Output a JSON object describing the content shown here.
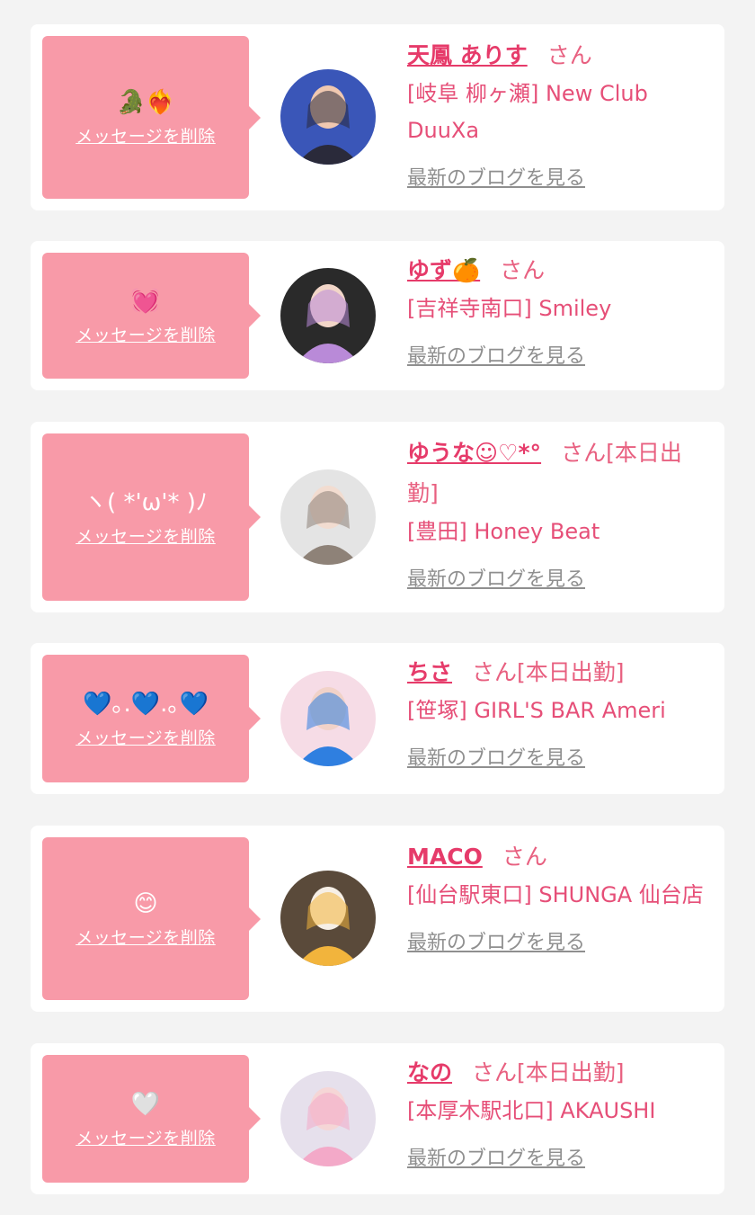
{
  "common": {
    "san": "さん",
    "delete_label": "メッセージを削除",
    "blog_label": "最新のブログを見る"
  },
  "cards": [
    {
      "message": "🐊❤️‍🔥",
      "name": "天鳳 ありす",
      "tag": "",
      "shop": "[岐阜 柳ヶ瀬] New Club DuuXa",
      "avatar_icon": "portrait-photo",
      "avatar_colors": [
        "#3a56b8",
        "#f0c8b0",
        "#2a2a3a"
      ]
    },
    {
      "message": "💓",
      "name": "ゆず🍊",
      "tag": "",
      "shop": "[吉祥寺南口] Smiley",
      "avatar_icon": "portrait-photo",
      "avatar_colors": [
        "#2a2a2a",
        "#f2d6c8",
        "#b98ad8"
      ]
    },
    {
      "message": "ヽ( *'ω'* )ﾉ",
      "name": "ゆうな☺︎♡*°",
      "tag": "[本日出勤]",
      "shop": "[豊田] Honey Beat",
      "avatar_icon": "portrait-photo",
      "avatar_colors": [
        "#e4e4e4",
        "#f2dcd0",
        "#8e8278"
      ]
    },
    {
      "message": "💙｡.💙.｡💙",
      "name": "ちさ",
      "tag": "[本日出勤]",
      "shop": "[笹塚] GIRL'S BAR Ameri",
      "avatar_icon": "portrait-photo",
      "avatar_colors": [
        "#f6dce6",
        "#f1d2c8",
        "#2f7fe0"
      ]
    },
    {
      "message": "😊",
      "name": "MACO",
      "tag": "",
      "shop": "[仙台駅東口] SHUNGA 仙台店",
      "avatar_icon": "portrait-photo",
      "avatar_colors": [
        "#5a4a3a",
        "#f6efe6",
        "#f2b43c"
      ]
    },
    {
      "message": "🤍",
      "name": "なの",
      "tag": "[本日出勤]",
      "shop": "[本厚木駅北口] AKAUSHI",
      "avatar_icon": "portrait-photo",
      "avatar_colors": [
        "#e6e0ec",
        "#f5d6d6",
        "#f3a9c8"
      ]
    }
  ]
}
